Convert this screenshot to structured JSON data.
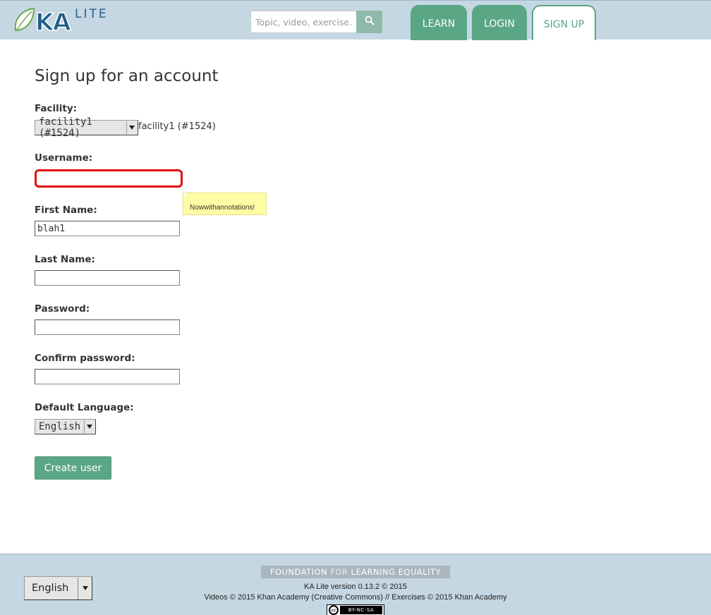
{
  "header": {
    "logo_text": "KALITE",
    "search": {
      "placeholder": "Topic, video, exercise..."
    },
    "nav": [
      {
        "label": "LEARN"
      },
      {
        "label": "LOGIN"
      },
      {
        "label": "SIGN UP"
      }
    ],
    "colors": {
      "header_bg": "#c5d7e2",
      "accent": "#5aa685"
    }
  },
  "form": {
    "title": "Sign up for an account",
    "facility": {
      "label": "Facility:",
      "selected": "facility1 (#1524)",
      "display_text": "facility1 (#1524)"
    },
    "username": {
      "label": "Username:",
      "value": ""
    },
    "tooltip": "Nowwithannotations!",
    "first_name": {
      "label": "First Name:",
      "value": "blah1"
    },
    "last_name": {
      "label": "Last Name:",
      "value": ""
    },
    "password": {
      "label": "Password:",
      "value": ""
    },
    "confirm_password": {
      "label": "Confirm password:",
      "value": ""
    },
    "default_language": {
      "label": "Default Language:",
      "selected": "English"
    },
    "submit_label": "Create user"
  },
  "footer": {
    "language": "English",
    "fle_banner": {
      "left": "FOUNDATION",
      "middle": "FOR",
      "right": "LEARNING EQUALITY"
    },
    "version": "KA Lite version 0.13.2 © 2015",
    "credits": "Videos © 2015 Khan Academy (Creative Commons) // Exercises © 2015 Khan Academy",
    "license_badge": "BY-NC-SA",
    "cc_text": "cc"
  }
}
